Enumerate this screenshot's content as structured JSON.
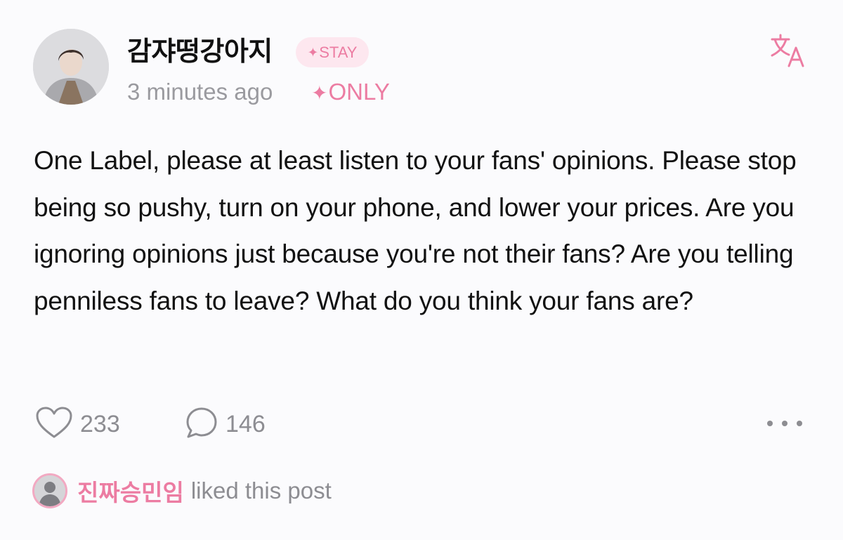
{
  "author": {
    "username": "감쟈떵강아지",
    "badge": "STAY",
    "timestamp": "3 minutes ago",
    "visibility": "ONLY"
  },
  "post": {
    "text": "One Label, please at least listen to your fans' opinions. Please stop being so pushy, turn on your phone, and lower your prices. Are you ignoring opinions just because you're not their fans? Are you telling penniless fans to leave? What do you think your fans are?"
  },
  "actions": {
    "likes": "233",
    "comments": "146"
  },
  "liked_by": {
    "name": "진짜승민임",
    "suffix": "liked this post"
  },
  "icons": {
    "translate": "translate-icon",
    "like": "heart-icon",
    "comment": "comment-bubble-icon",
    "more": "more-dots-icon",
    "sparkle": "sparkle-icon"
  },
  "colors": {
    "accent_pink": "#ec7ca2",
    "badge_bg": "#fde7ef",
    "muted_text": "#8d8d92",
    "background": "#fbfbfd"
  }
}
